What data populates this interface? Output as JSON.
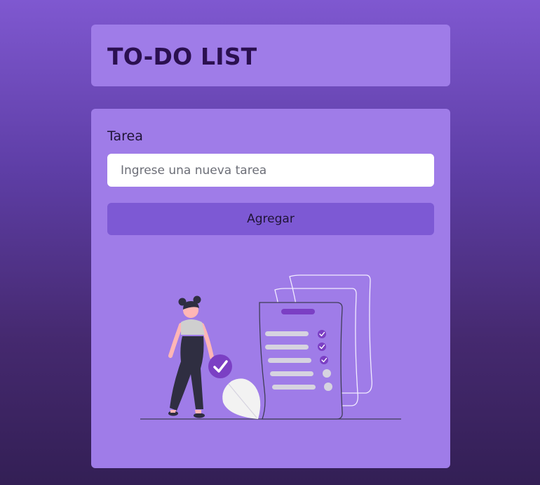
{
  "header": {
    "title": "TO-DO LIST"
  },
  "form": {
    "task_label": "Tarea",
    "input_value": "",
    "input_placeholder": "Ingrese una nueva tarea",
    "add_button_label": "Agregar"
  },
  "illustration": {
    "icon": "woman-with-checklist-illustration",
    "checked_items": 3,
    "total_items": 5
  },
  "colors": {
    "background_top": "#7f58d0",
    "background_bottom": "#331f55",
    "card": "#9f7ce8",
    "button": "#7d59d4",
    "title_text": "#2b1050",
    "accent": "#7b3fc4"
  }
}
